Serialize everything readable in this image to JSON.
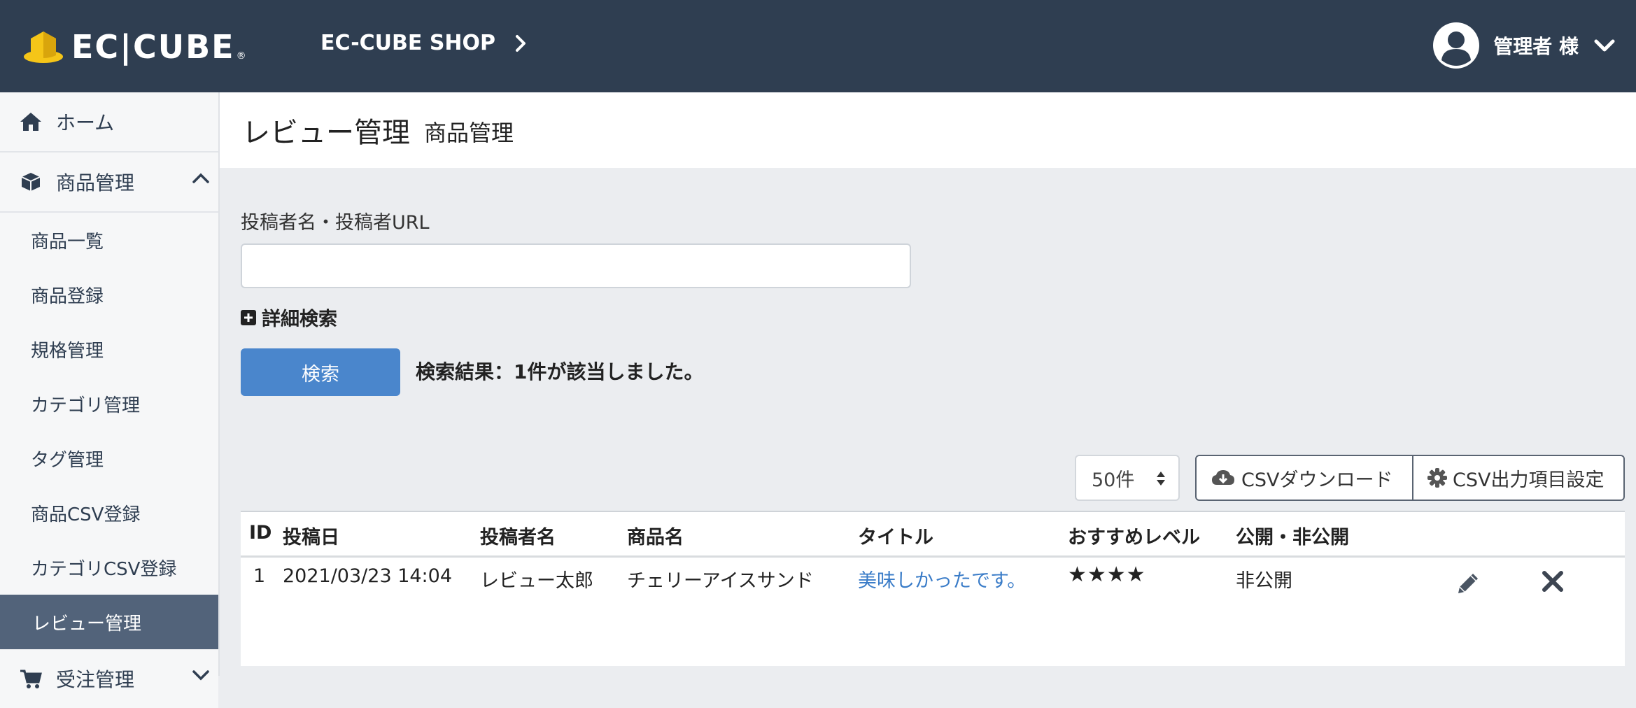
{
  "header": {
    "logo_text": "EC|CUBE",
    "logo_reg": "®",
    "shop_name": "EC-CUBE SHOP",
    "user_label": "管理者 様",
    "bg_color": "#2f3e51"
  },
  "sidebar": {
    "items": [
      {
        "label": "ホーム",
        "icon": "home-icon"
      },
      {
        "label": "商品管理",
        "icon": "cube-icon",
        "expanded": true
      }
    ],
    "subitems": [
      {
        "label": "商品一覧"
      },
      {
        "label": "商品登録"
      },
      {
        "label": "規格管理"
      },
      {
        "label": "カテゴリ管理"
      },
      {
        "label": "タグ管理"
      },
      {
        "label": "商品CSV登録"
      },
      {
        "label": "カテゴリCSV登録"
      },
      {
        "label": "レビュー管理",
        "active": true
      }
    ],
    "next_item": {
      "label": "受注管理",
      "icon": "cart-icon"
    },
    "active_color": "#52637a"
  },
  "page": {
    "title": "レビュー管理",
    "subtitle": "商品管理"
  },
  "search": {
    "label": "投稿者名・投稿者URL",
    "value": "",
    "placeholder": "",
    "detail_label": "詳細検索",
    "button_label": "検索",
    "result_text": "検索結果：1件が該当しました。",
    "button_color": "#4a86cc"
  },
  "toolbar": {
    "per_page": "50件",
    "csv_download": "CSVダウンロード",
    "csv_settings": "CSV出力項目設定"
  },
  "table": {
    "headers": [
      "ID",
      "投稿日",
      "投稿者名",
      "商品名",
      "タイトル",
      "おすすめレベル",
      "公開・非公開"
    ],
    "rows": [
      {
        "id": "1",
        "date": "2021/03/23 14:04",
        "author": "レビュー太郎",
        "product": "チェリーアイスサンド",
        "title": "美味しかったです。",
        "stars": "★★★★",
        "status": "非公開"
      }
    ],
    "link_color": "#3a7cc8"
  }
}
